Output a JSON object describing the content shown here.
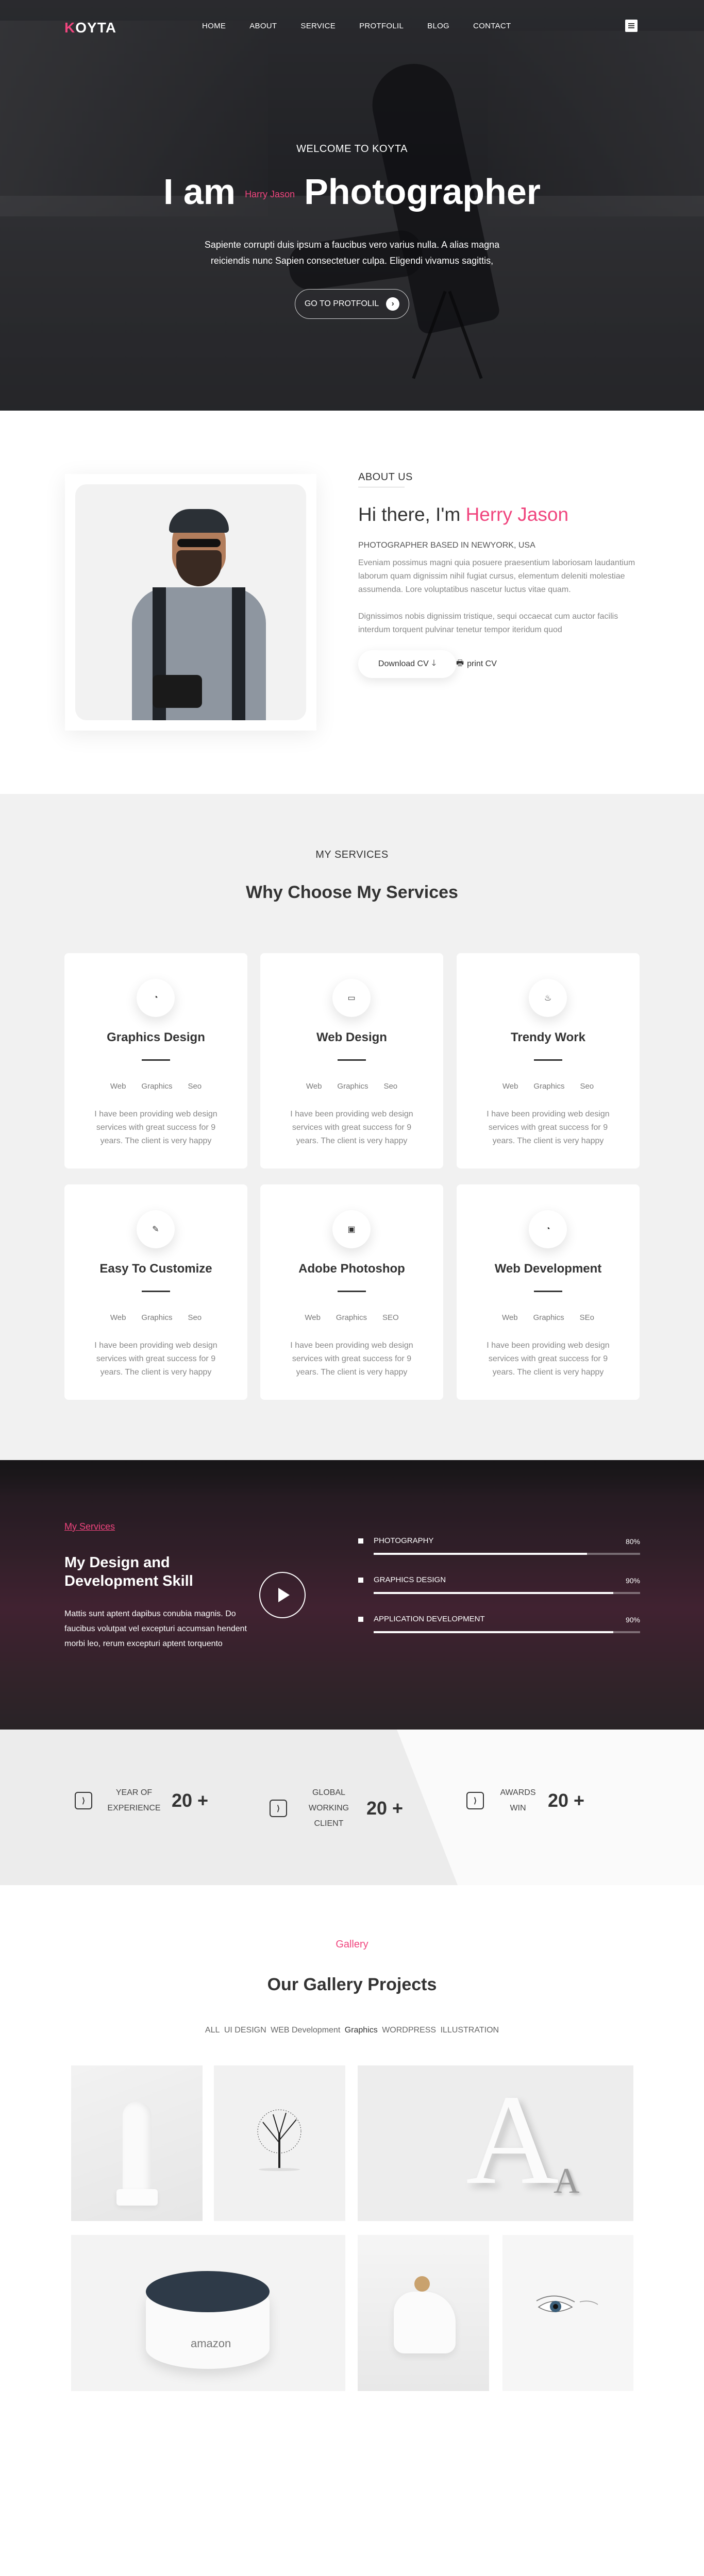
{
  "brand": {
    "logo": "KOYTA",
    "accent": "#f0457e"
  },
  "nav": {
    "items": [
      "HOME",
      "ABOUT",
      "SERVICE",
      "PROTFOLIL",
      "BLOG",
      "CONTACT"
    ]
  },
  "hero": {
    "kicker": "WELCOME TO KOYTA",
    "title_prefix": "I am",
    "title_name": "Harry Jason",
    "title_suffix": "Photographer",
    "subtitle_line1": "Sapiente corrupti duis ipsum a faucibus vero varius nulla. A alias magna",
    "subtitle_line2": "reiciendis nunc Sapien consectetuer culpa. Eligendi vivamus sagittis,",
    "button_label": "GO TO PROTFOLIL",
    "button_icon": "›"
  },
  "about": {
    "kicker": "ABOUT US",
    "title_prefix": "Hi there, I'm",
    "title_name": "Herry Jason",
    "based": "PHOTOGRAPHER BASED IN NEWYORK, USA",
    "p1": "Eveniam possimus magni quia posuere praesentium laboriosam laudantium laborum quam dignissim nihil fugiat cursus, elementum deleniti molestiae assumenda. Lore voluptatibus nascetur luctus vitae quam.",
    "p2": "Dignissimos nobis dignissim tristique, sequi occaecat cum auctor facilis interdum torquent pulvinar tenetur tempor iteridum quod",
    "download_label": "Download CV",
    "download_icon": "🡓",
    "print_label": "print CV",
    "print_icon": "🖶"
  },
  "services": {
    "kicker": "MY SERVICES",
    "title": "Why Choose My Services",
    "cards": [
      {
        "title": "Graphics Design",
        "icon": "palette-icon",
        "glyph": "◔",
        "tags": [
          "Web",
          "Graphics",
          "Seo"
        ],
        "desc": "I have been providing web design services with great success for 9 years. The client is very happy"
      },
      {
        "title": "Web Design",
        "icon": "monitor-icon",
        "glyph": "▭",
        "tags": [
          "Web",
          "Graphics",
          "Seo"
        ],
        "desc": "I have been providing web design services with great success for 9 years. The client is very happy"
      },
      {
        "title": "Trendy Work",
        "icon": "flame-icon",
        "glyph": "♨",
        "tags": [
          "Web",
          "Graphics",
          "Seo"
        ],
        "desc": "I have been providing web design services with great success for 9 years. The client is very happy"
      },
      {
        "title": "Easy To Customize",
        "icon": "edit-icon",
        "glyph": "✎",
        "tags": [
          "Web",
          "Graphics",
          "Seo"
        ],
        "desc": "I have been providing web design services with great success for 9 years. The client is very happy"
      },
      {
        "title": "Adobe Photoshop",
        "icon": "image-icon",
        "glyph": "▣",
        "tags": [
          "Web",
          "Graphics",
          "SEO"
        ],
        "desc": "I have been providing web design services with great success for 9 years. The client is very happy"
      },
      {
        "title": "Web Development",
        "icon": "palette-icon",
        "glyph": "◔",
        "tags": [
          "Web",
          "Graphics",
          "SEo"
        ],
        "desc": "I have been providing web design services with great success for 9 years. The client is very happy"
      }
    ]
  },
  "skills": {
    "kicker": "My Services",
    "title": "My Design and Development Skill",
    "text": "Mattis sunt aptent dapibus conubia magnis. Do faucibus volutpat vel excepturi accumsan hendent morbi leo, rerum excepturi aptent torquento",
    "bars": [
      {
        "label": "PHOTOGRAPHY",
        "percent_text": "80%",
        "value": 0.8
      },
      {
        "label": "GRAPHICS DESIGN",
        "percent_text": "90%",
        "value": 0.9
      },
      {
        "label": "APPLICATION DEVELOPMENT",
        "percent_text": "90%",
        "value": 0.9
      }
    ]
  },
  "counters": [
    {
      "label_line1": "YEAR OF",
      "label_line2": "EXPERIENCE",
      "value": "20 +"
    },
    {
      "label_line1": "GLOBAL WORKING",
      "label_line2": "CLIENT",
      "value": "20 +"
    },
    {
      "label_line1": "AWARDS",
      "label_line2": "WIN",
      "value": "20 +"
    }
  ],
  "gallery": {
    "kicker": "Gallery",
    "title": "Our Gallery Projects",
    "filters": [
      "ALL",
      "UI DESIGN",
      "WEB Development",
      "Graphics",
      "WORDPRESS",
      "ILLUSTRATION"
    ],
    "items": [
      "Statue",
      "Tree",
      "Letter A",
      "Amazon Echo",
      "Hand",
      "Eye"
    ],
    "echo_text": "amazon"
  }
}
